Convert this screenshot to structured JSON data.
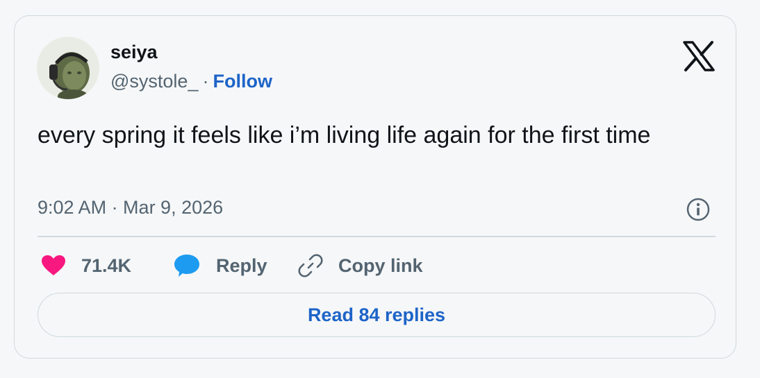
{
  "author": {
    "name": "seiya",
    "handle": "@systole_",
    "separator": "·",
    "follow_label": "Follow"
  },
  "tweet": {
    "text": "every spring it feels like i’m living life again for the first time",
    "timestamp": "9:02 AM · Mar 9, 2026"
  },
  "actions": {
    "like_count": "71.4K",
    "reply_label": "Reply",
    "copy_link_label": "Copy link"
  },
  "read_replies_label": "Read 84 replies",
  "icons": {
    "platform": "x-logo-icon",
    "info": "info-icon",
    "like": "heart-icon",
    "reply": "speech-bubble-icon",
    "copy": "link-icon"
  },
  "colors": {
    "heart": "#f91880",
    "reply_bubble": "#1d9bf0",
    "link_blue": "#1d64c8",
    "secondary_text": "#536471",
    "border": "#cfd9de",
    "background": "#f6f7f8"
  }
}
